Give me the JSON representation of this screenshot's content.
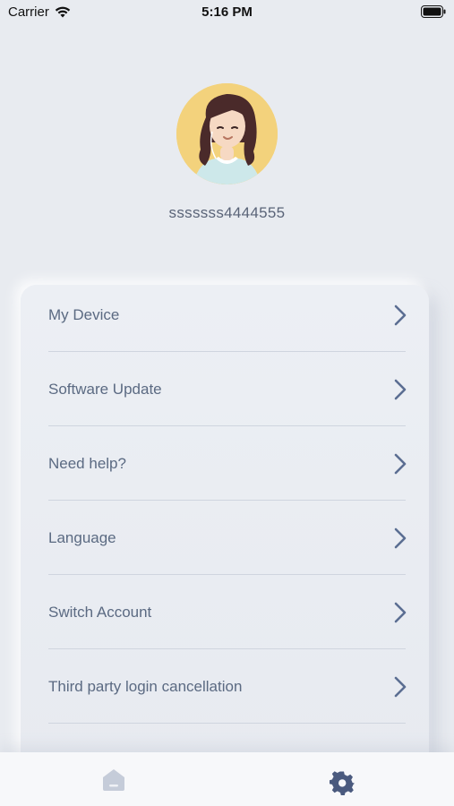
{
  "status_bar": {
    "carrier": "Carrier",
    "time": "5:16 PM"
  },
  "profile": {
    "username": "sssssss4444555"
  },
  "menu": {
    "items": [
      {
        "label": "My Device"
      },
      {
        "label": "Software Update"
      },
      {
        "label": "Need help?"
      },
      {
        "label": "Language"
      },
      {
        "label": "Switch Account"
      },
      {
        "label": "Third party login cancellation"
      }
    ]
  },
  "tab_bar": {
    "tabs": [
      {
        "icon": "home-icon",
        "active": false
      },
      {
        "icon": "gear-icon",
        "active": true
      }
    ]
  },
  "colors": {
    "background": "#e8ebf0",
    "text_primary": "#5b6a82",
    "chevron": "#5b6e92",
    "avatar_bg": "#f3d27c",
    "tab_active": "#4a5a7e",
    "tab_inactive": "#c5ccd9"
  }
}
